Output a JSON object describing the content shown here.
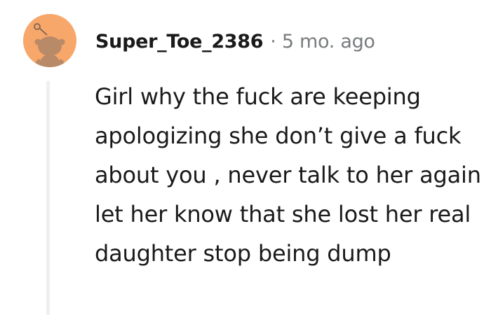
{
  "comment": {
    "author": "Super_Toe_2386",
    "separator": "·",
    "timestamp": "5 mo. ago",
    "avatar_icon": "snoo-avatar-icon",
    "body": "Girl why the fuck are keeping apologizing she don’t give a fuck about you , never talk to her again let her know that she lost her real daughter stop being dump"
  },
  "colors": {
    "avatar_bg": "#f8a76a",
    "username": "#1a1a1b",
    "meta": "#787c7e",
    "thread_line": "#edeff1"
  }
}
